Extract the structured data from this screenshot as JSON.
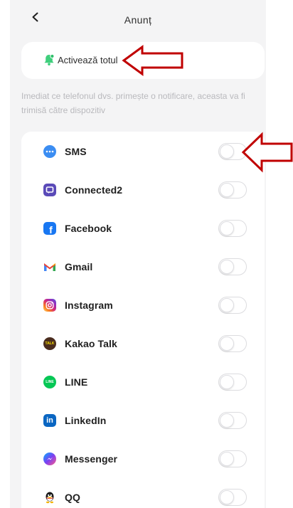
{
  "header": {
    "title": "Anunț",
    "back_icon": "chevron-left-icon"
  },
  "enable_all": {
    "label": "Activează totul",
    "icon": "bell-icon",
    "accent": "#3fcf7c"
  },
  "note": "Imediat ce telefonul dvs. primește o notificare, aceasta va fi trimisă către dispozitiv",
  "apps": [
    {
      "name": "sms",
      "label": "SMS",
      "icon": "sms-icon",
      "color": "#3b8df2",
      "enabled": false
    },
    {
      "name": "connected2",
      "label": "Connected2",
      "icon": "connected2-icon",
      "color": "#5a4ab8",
      "enabled": false
    },
    {
      "name": "facebook",
      "label": "Facebook",
      "icon": "facebook-icon",
      "color": "#1877f2",
      "enabled": false
    },
    {
      "name": "gmail",
      "label": "Gmail",
      "icon": "gmail-icon",
      "color": "#ea4335",
      "enabled": false
    },
    {
      "name": "instagram",
      "label": "Instagram",
      "icon": "instagram-icon",
      "color": "#d62976",
      "enabled": false
    },
    {
      "name": "kakao-talk",
      "label": "Kakao Talk",
      "icon": "kakao-talk-icon",
      "color": "#3c1e1e",
      "enabled": false
    },
    {
      "name": "line",
      "label": "LINE",
      "icon": "line-icon",
      "color": "#06c755",
      "enabled": false
    },
    {
      "name": "linkedin",
      "label": "LinkedIn",
      "icon": "linkedin-icon",
      "color": "#0a66c2",
      "enabled": false
    },
    {
      "name": "messenger",
      "label": "Messenger",
      "icon": "messenger-icon",
      "color": "#7b3ff2",
      "enabled": false
    },
    {
      "name": "qq",
      "label": "QQ",
      "icon": "qq-icon",
      "color": "#1a1a1a",
      "enabled": false
    }
  ],
  "annotations": {
    "arrow_color": "#c00000"
  }
}
